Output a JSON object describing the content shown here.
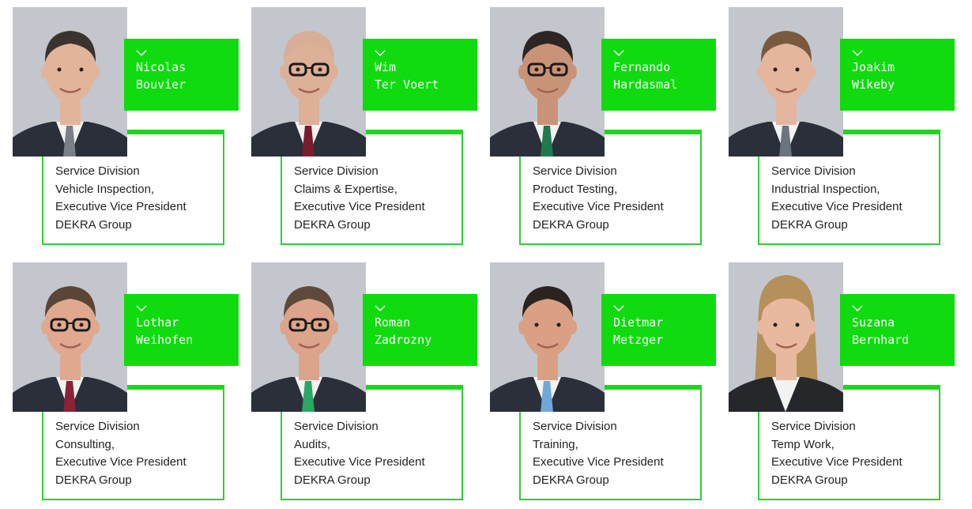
{
  "people": [
    {
      "first": "Nicolas",
      "last": "Bouvier",
      "lines": [
        "Service Division",
        "Vehicle Inspection,",
        "Executive Vice President",
        "DEKRA Group"
      ],
      "hair": "#3a3330",
      "skin": "#e2b49a",
      "tie": "#7a7f88",
      "glasses": false,
      "female": false
    },
    {
      "first": "Wim",
      "last": "Ter Voert",
      "lines": [
        "Service Division",
        "Claims & Expertise,",
        "Executive Vice President",
        "DEKRA Group"
      ],
      "hair": "#d9ad98",
      "skin": "#ddb098",
      "tie": "#7b1b2e",
      "glasses": true,
      "female": false
    },
    {
      "first": "Fernando",
      "last": "Hardasmal",
      "lines": [
        "Service Division",
        "Product Testing,",
        "Executive Vice President",
        "DEKRA Group"
      ],
      "hair": "#2c2523",
      "skin": "#c99378",
      "tie": "#1f7a4d",
      "glasses": true,
      "female": false
    },
    {
      "first": "Joakim",
      "last": "Wikeby",
      "lines": [
        "Service Division",
        "Industrial Inspection,",
        "Executive Vice President",
        "DEKRA Group"
      ],
      "hair": "#7a5a3e",
      "skin": "#e4b69e",
      "tie": "#6c7480",
      "glasses": false,
      "female": false
    },
    {
      "first": "Lothar",
      "last": "Weihofen",
      "lines": [
        "Service Division",
        "Consulting,",
        "Executive Vice President",
        "DEKRA Group"
      ],
      "hair": "#5a4536",
      "skin": "#e0a98f",
      "tie": "#8b2235",
      "glasses": true,
      "female": false
    },
    {
      "first": "Roman",
      "last": "Zadrozny",
      "lines": [
        "Service Division",
        "Audits,",
        "Executive Vice President",
        "DEKRA Group"
      ],
      "hair": "#5e4a3c",
      "skin": "#dca48a",
      "tie": "#2aa863",
      "glasses": true,
      "female": false
    },
    {
      "first": "Dietmar",
      "last": "Metzger",
      "lines": [
        "Service Division",
        "Training,",
        "Executive Vice President",
        "DEKRA Group"
      ],
      "hair": "#2b2320",
      "skin": "#d9a084",
      "tie": "#6fa8d8",
      "glasses": false,
      "female": false
    },
    {
      "first": "Suzana",
      "last": "Bernhard",
      "lines": [
        "Service Division",
        "Temp Work,",
        "Executive Vice President",
        "DEKRA Group"
      ],
      "hair": "#b5905a",
      "skin": "#e8b99f",
      "tie": "#555a63",
      "glasses": false,
      "female": true
    }
  ]
}
